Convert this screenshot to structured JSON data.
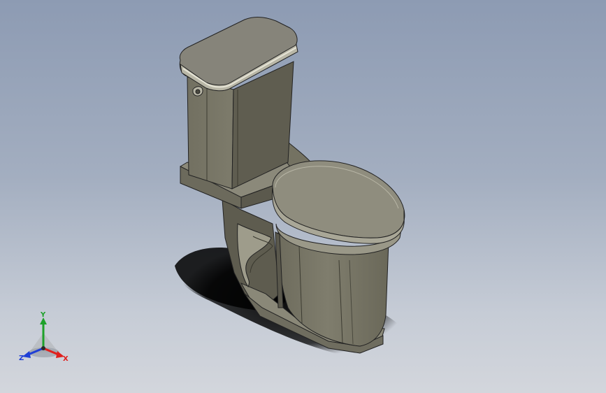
{
  "viewport": {
    "background_top": "#8d9bb3",
    "background_bottom": "#d3d6dc"
  },
  "model": {
    "part_color": "#7d7b6b",
    "icon": "toilet-3d-model"
  },
  "triad": {
    "x_label": "X",
    "y_label": "Y",
    "z_label": "Z",
    "x_color": "#e0201d",
    "y_color": "#1ea12a",
    "z_color": "#1f3fd6"
  }
}
